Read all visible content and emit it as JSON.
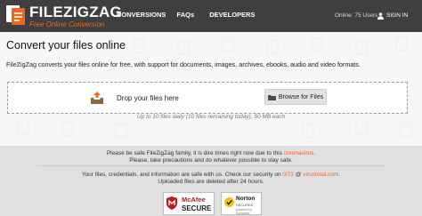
{
  "header": {
    "title": "FILEZIGZAG",
    "subtitle": "Free Online Conversion",
    "nav": [
      "CONVERSIONS",
      "FAQs",
      "DEVELOPERS"
    ],
    "online_users": "Online: 75 Users",
    "signin": "SIGN IN"
  },
  "main": {
    "page_title": "Convert your files online",
    "intro": "FileZigZag converts your files online for free, with support for documents, images, archives, ebooks, audio and video formats.",
    "drop_label": "Drop your files here",
    "browse_label": "Browse for Files",
    "limit": "Up to 10 files daily (10 files remaining today), 50 MB each"
  },
  "notices": {
    "war_prefix": "Please be safe FileZigZag family, it is dire times right now due to this ",
    "war_link": "coronavirus",
    "war_suffix": ".",
    "precautions": "Please, take precautions and do whatever possible to stay safe.",
    "security_prefix": "Your files, credentials, and information are safe with us. Check our security on ",
    "security_link1": "0/72",
    "security_mid": " @ ",
    "security_link2": "virustotal.com",
    "security_suffix": ".",
    "deleted": "Uploaded files are deleted after 24 hours."
  },
  "badges": {
    "mcafee_brand": "McAfee",
    "mcafee_secure": "SECURE",
    "norton_brand": "Norton",
    "norton_secured": "SECURED",
    "norton_by": "powered by Symantec"
  },
  "colors": {
    "header_bg": "#3f3f3f",
    "accent": "#e86a1d",
    "page_bg": "#f7f7f7",
    "notice_bg": "#e0e0e0"
  },
  "icons": [
    "logo-icon",
    "user-group-icon",
    "person-icon",
    "upload-box-icon",
    "folder-icon",
    "mcafee-shield-icon",
    "norton-check-icon"
  ]
}
